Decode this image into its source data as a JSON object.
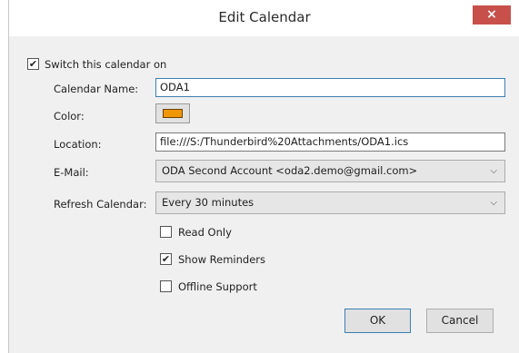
{
  "window": {
    "title": "Edit Calendar",
    "close_glyph": "×"
  },
  "form": {
    "switch_on": {
      "label": "Switch this calendar on",
      "checked": true
    },
    "calendar_name": {
      "label": "Calendar Name:",
      "value": "ODA1"
    },
    "color": {
      "label": "Color:",
      "value": "#f09609"
    },
    "location": {
      "label": "Location:",
      "value": "file:///S:/Thunderbird%20Attachments/ODA1.ics"
    },
    "email": {
      "label": "E-Mail:",
      "value": "ODA Second Account <oda2.demo@gmail.com>"
    },
    "refresh": {
      "label": "Refresh Calendar:",
      "value": "Every 30 minutes"
    },
    "read_only": {
      "label": "Read Only",
      "checked": false
    },
    "show_reminders": {
      "label": "Show Reminders",
      "checked": true
    },
    "offline_support": {
      "label": "Offline Support",
      "checked": false
    }
  },
  "buttons": {
    "ok": "OK",
    "cancel": "Cancel"
  },
  "icons": {
    "dropdown_arrow": "chevron-down-icon",
    "check_mark": "✔"
  }
}
